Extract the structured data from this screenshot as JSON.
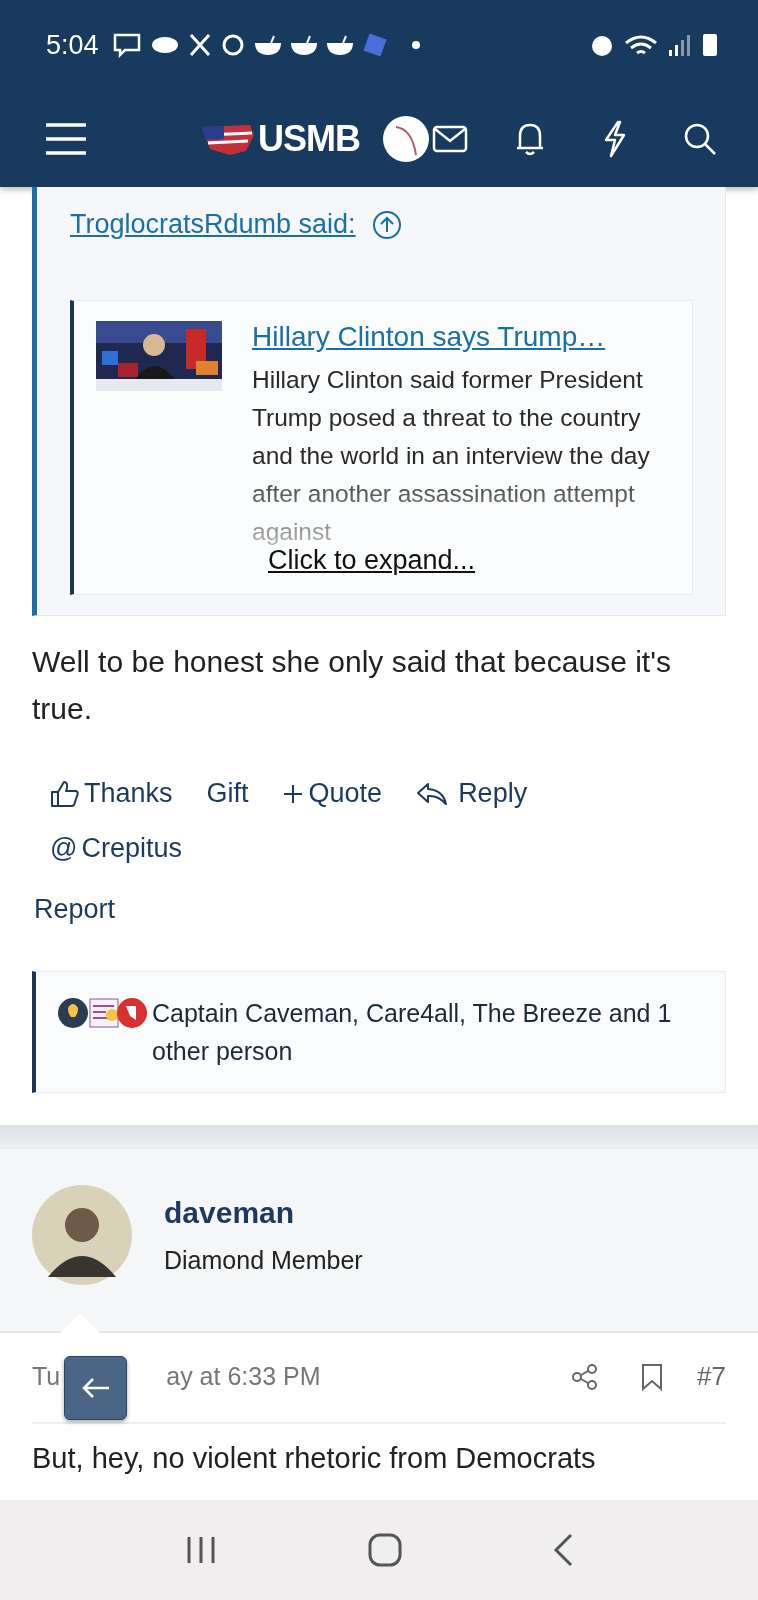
{
  "status_bar": {
    "time": "5:04"
  },
  "header": {
    "logo": "USMB"
  },
  "quote": {
    "author": "TroglocratsRdumb said:",
    "embed": {
      "title": "Hillary Clinton says Trump…",
      "description": "Hillary Clinton said former President Trump posed a threat to the country and the world in an interview the day after another assassination attempt against"
    },
    "expand": "Click to expand..."
  },
  "body": "Well to be honest she only said that because it's true.",
  "actions": [
    {
      "kind": "thanks",
      "label": "Thanks"
    },
    {
      "kind": "gift",
      "label": "Gift"
    },
    {
      "kind": "quote",
      "label": "Quote"
    },
    {
      "kind": "reply",
      "label": "Reply"
    },
    {
      "kind": "mention",
      "symbol": "@",
      "label": "Crepitus"
    }
  ],
  "report": "Report",
  "reactions": {
    "text": "Captain Caveman, Care4all, The Breeze and 1 other person"
  },
  "next_post": {
    "author": "daveman",
    "role": "Diamond Member",
    "date_start": "Tu",
    "date_end": "ay at 6:33 PM",
    "number": "#7",
    "body_start": "But, hey, no violent rhetoric from Democrats"
  }
}
